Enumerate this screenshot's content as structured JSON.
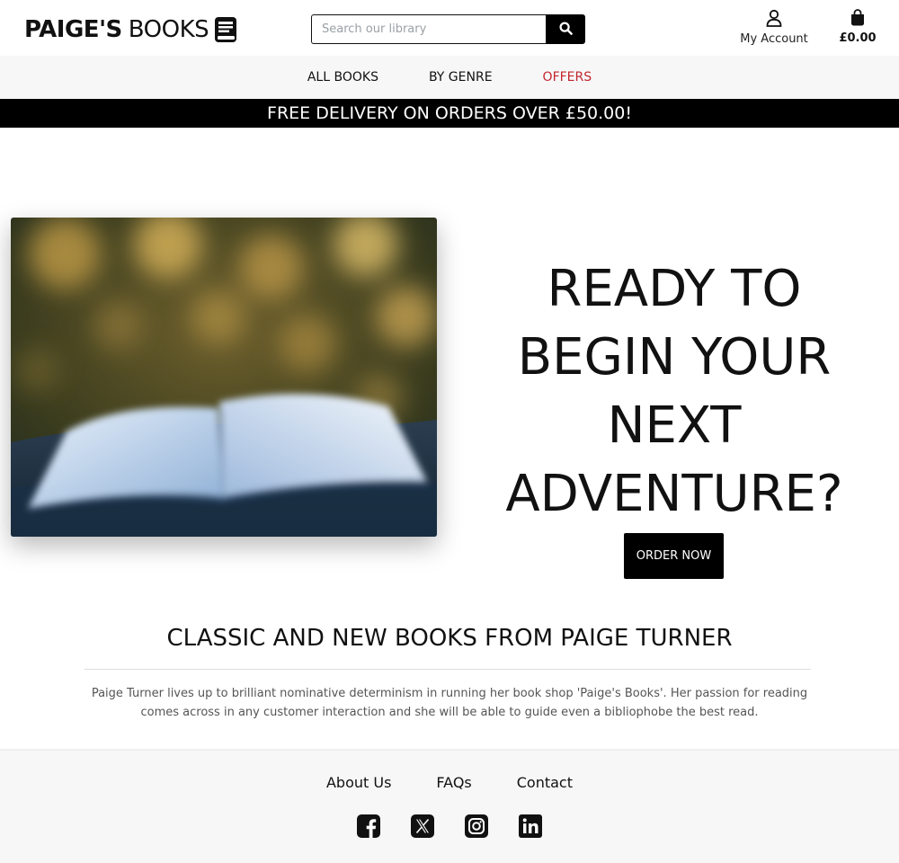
{
  "header": {
    "logo_bold": "PAIGE'S",
    "logo_light": "BOOKS",
    "logo_icon": "book-icon",
    "search": {
      "placeholder": "Search our library",
      "icon": "search-icon"
    },
    "account": {
      "label": "My Account",
      "icon": "user-icon"
    },
    "bag": {
      "total": "£0.00",
      "icon": "shopping-bag-icon"
    }
  },
  "nav": {
    "items": [
      {
        "label": "ALL BOOKS"
      },
      {
        "label": "BY GENRE"
      },
      {
        "label": "OFFERS"
      }
    ],
    "accent_color": "#c1272d"
  },
  "banner": {
    "text": "FREE DELIVERY ON ORDERS OVER £50.00!"
  },
  "hero": {
    "image": "open-book-photo",
    "lines": [
      "READY TO",
      "BEGIN YOUR",
      "NEXT",
      "ADVENTURE?"
    ],
    "button": "ORDER NOW"
  },
  "about": {
    "title": "CLASSIC AND NEW BOOKS FROM PAIGE TURNER",
    "text": "Paige Turner lives up to brilliant nominative determinism in running her book shop 'Paige's Books'. Her passion for reading comes across in any customer interaction and she will be able to guide even a bibliophobe the best read."
  },
  "footer": {
    "links": [
      {
        "label": "About Us"
      },
      {
        "label": "FAQs"
      },
      {
        "label": "Contact"
      }
    ],
    "socials": [
      "facebook-icon",
      "x-icon",
      "instagram-icon",
      "linkedin-icon"
    ]
  }
}
